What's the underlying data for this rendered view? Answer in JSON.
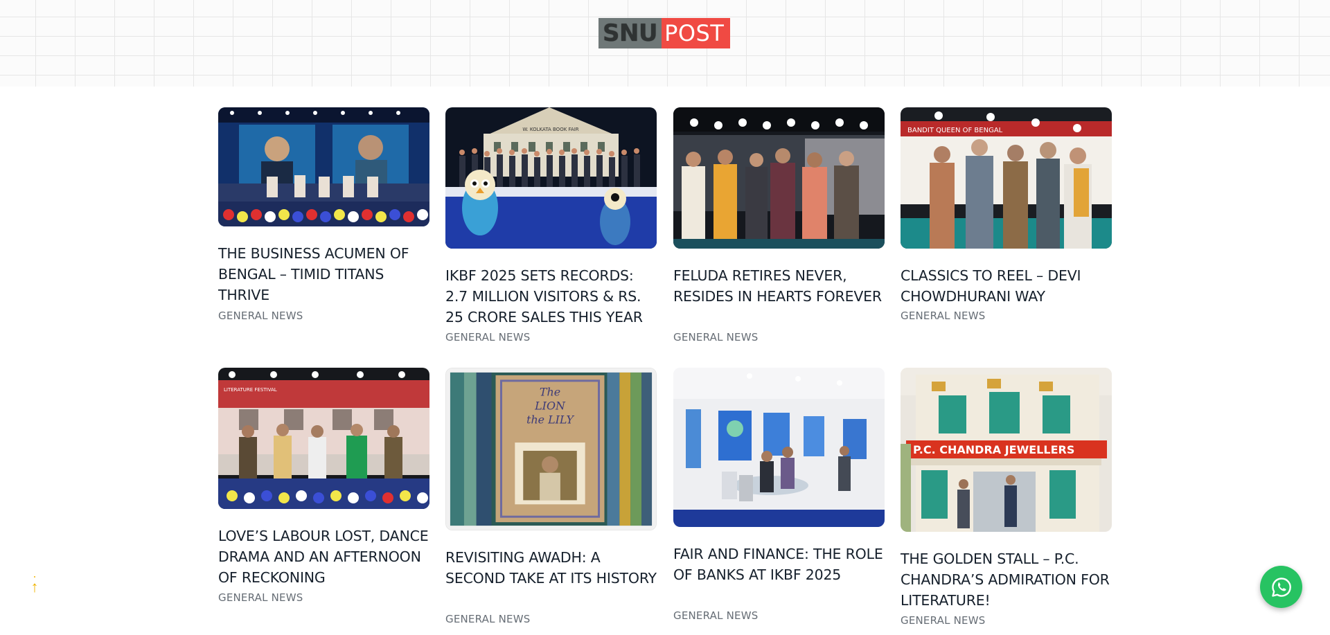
{
  "site": {
    "logo_left": "SNU",
    "logo_right": "POST"
  },
  "articles": [
    {
      "title": "THE BUSINESS ACUMEN OF BENGAL – TIMID TITANS THRIVE",
      "category": "GENERAL NEWS"
    },
    {
      "title": "IKBF 2025 SETS RECORDS: 2.7 MILLION VISITORS & RS. 25 CRORE SALES THIS YEAR",
      "category": "GENERAL NEWS"
    },
    {
      "title": "FELUDA RETIRES NEVER, RESIDES IN HEARTS FOREVER",
      "category": "GENERAL NEWS"
    },
    {
      "title": "CLASSICS TO REEL – DEVI CHOWDHURANI WAY",
      "category": "GENERAL NEWS"
    },
    {
      "title": "LOVE’S LABOUR LOST, DANCE DRAMA AND AN AFTERNOON OF RECKONING",
      "category": "GENERAL NEWS"
    },
    {
      "title": "REVISITING AWADH: A SECOND TAKE AT ITS HISTORY",
      "category": "GENERAL NEWS"
    },
    {
      "title": "FAIR AND FINANCE: THE ROLE OF BANKS AT IKBF 2025",
      "category": "GENERAL NEWS"
    },
    {
      "title": "THE GOLDEN STALL – P.C. CHANDRA’S ADMIRATION FOR LITERATURE!",
      "category": "GENERAL NEWS"
    }
  ],
  "images": {
    "img0": {
      "banner_text": ""
    },
    "img1": {
      "banner_text": "W. KOLKATA BOOK FAIR"
    },
    "img3": {
      "banner_text": "BANDIT QUEEN OF BENGAL"
    },
    "img4": {
      "banner_text": "LITERATURE FESTIVAL"
    },
    "img5": {
      "book_line1": "The",
      "book_line2": "LION",
      "book_line3": "the LILY"
    },
    "img7": {
      "sign": "P.C. CHANDRA JEWELLERS"
    }
  },
  "controls": {
    "back_to_top_icon": "arrow-up-icon",
    "whatsapp_icon": "whatsapp-icon"
  },
  "colors": {
    "logo_gray": "#6f7878",
    "logo_red": "#f04a43",
    "whatsapp_green": "#27c362",
    "back_to_top": "#f0b400"
  }
}
